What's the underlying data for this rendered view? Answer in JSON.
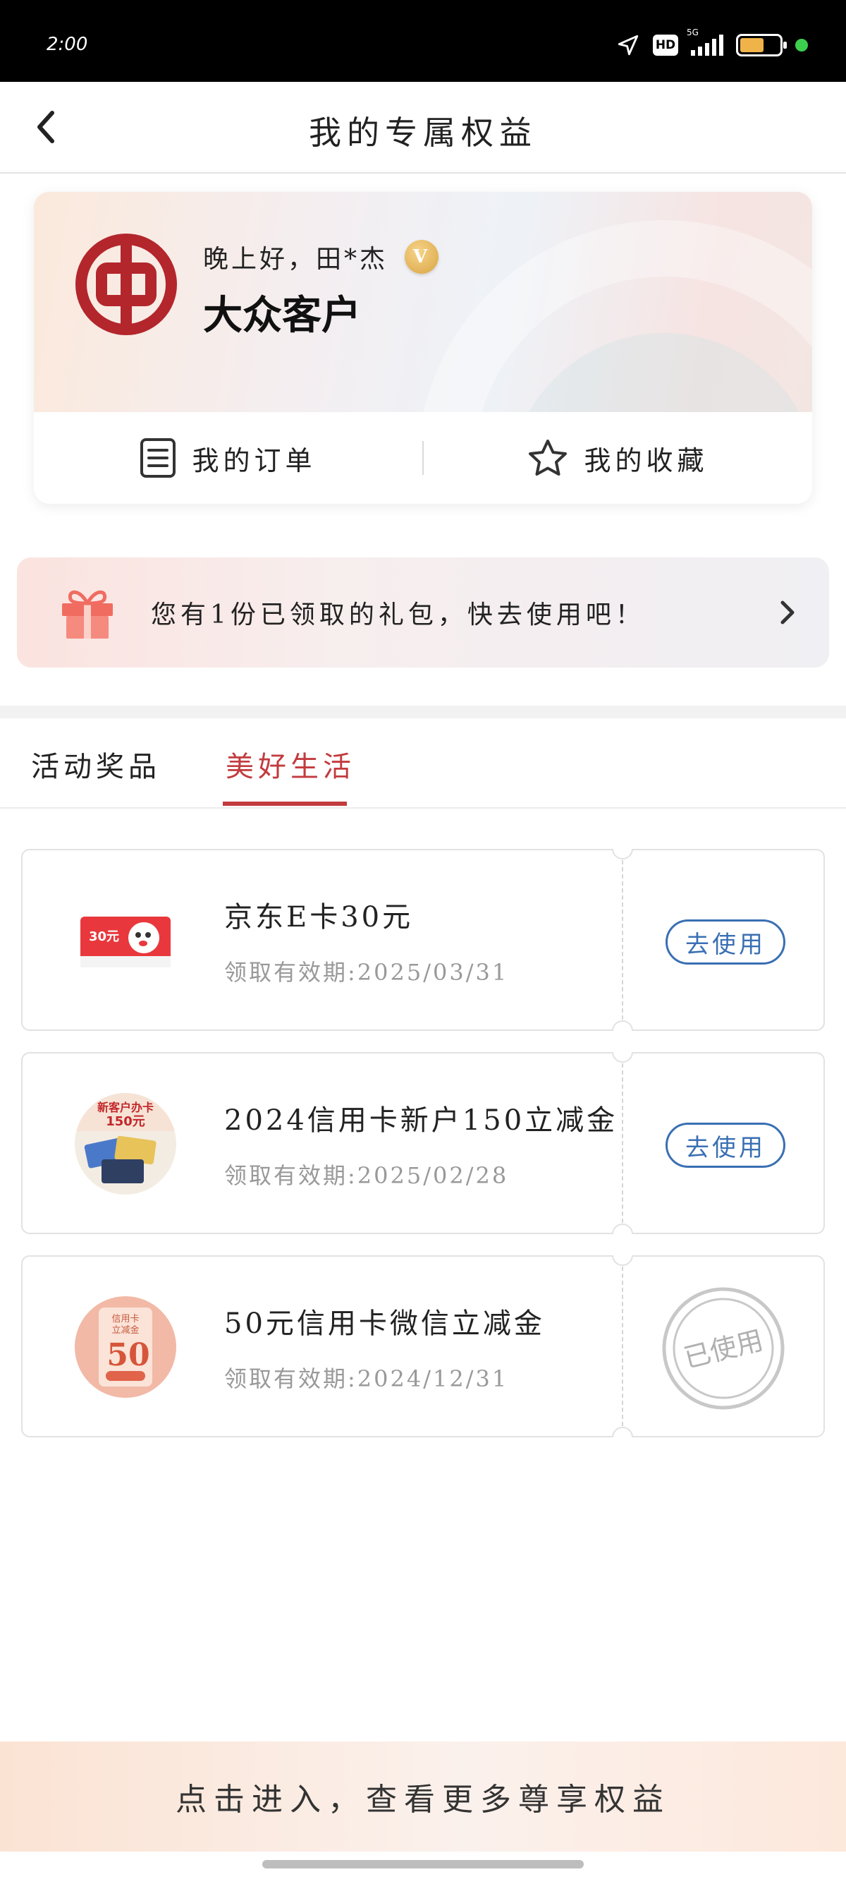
{
  "status_bar": {
    "time": "2:00",
    "hd": "HD",
    "network": "5G"
  },
  "header": {
    "title": "我的专属权益"
  },
  "profile": {
    "greeting": "晚上好，田*杰",
    "vip_badge": "V",
    "tier": "大众客户",
    "orders_label": "我的订单",
    "favorites_label": "我的收藏"
  },
  "gift_banner": {
    "text": "您有1份已领取的礼包，快去使用吧！"
  },
  "tabs": [
    {
      "label": "活动奖品",
      "active": false
    },
    {
      "label": "美好生活",
      "active": true
    }
  ],
  "coupons": [
    {
      "name": "京东E卡30元",
      "validity": "领取有效期:2025/03/31",
      "action": "去使用",
      "status": "available",
      "thumb_text": "30元"
    },
    {
      "name": "2024信用卡新户150立减金",
      "validity": "领取有效期:2025/02/28",
      "action": "去使用",
      "status": "available",
      "thumb_text": "150元"
    },
    {
      "name": "50元信用卡微信立减金",
      "validity": "领取有效期:2024/12/31",
      "action": "已使用",
      "status": "used",
      "thumb_text": "50"
    }
  ],
  "bottom_banner": {
    "text": "点击进入，查看更多尊享权益"
  },
  "colors": {
    "accent_red": "#c23b3e",
    "button_blue": "#3a6fb3",
    "boc_red": "#b3262c"
  }
}
